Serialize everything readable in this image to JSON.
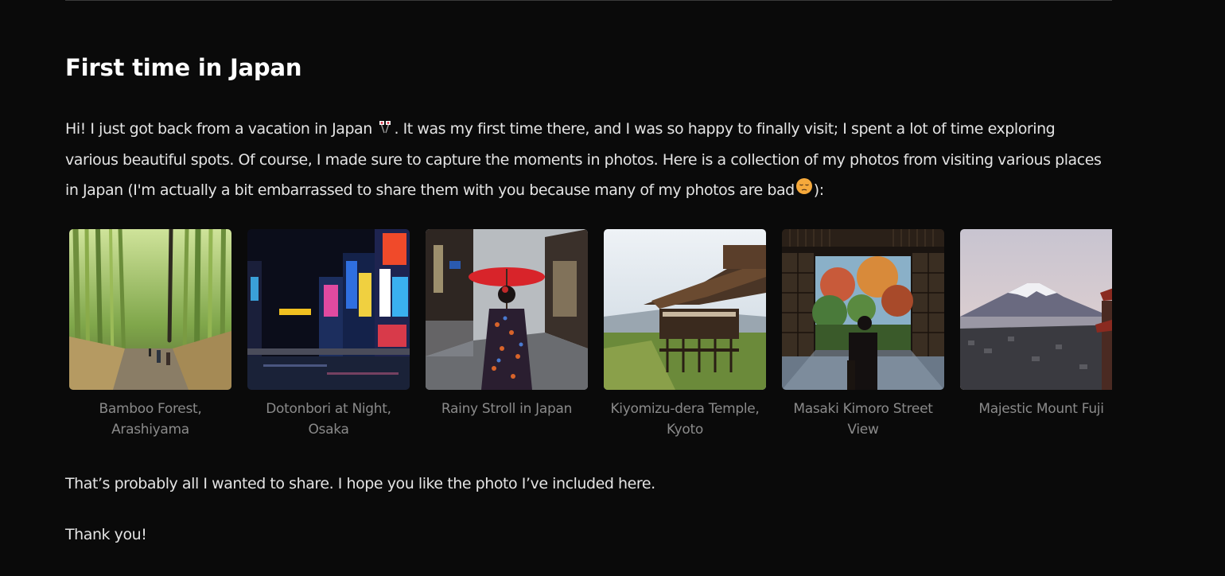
{
  "article": {
    "title": "First time in Japan",
    "intro_part1": "Hi! I just got back from a vacation in Japan ",
    "intro_part2": ". It was my first time there, and I was so happy to finally visit; I spent a lot of time exploring various beautiful spots. Of course, I made sure to capture the moments in photos. Here is a collection of my photos from visiting various places in Japan (I'm actually a bit embarrassed to share them with you because many of my photos are bad",
    "intro_part3": "):",
    "emoji_1": "crossed-flags-emoji",
    "emoji_2": "pensive-face-emoji",
    "closing": "That’s probably all I wanted to share. I hope you like the photo I’ve included here.",
    "thanks": "Thank you!"
  },
  "gallery": {
    "photos": [
      {
        "caption": "Bamboo Forest, Arashiyama"
      },
      {
        "caption": "Dotonbori at Night, Osaka"
      },
      {
        "caption": "Rainy Stroll in Japan"
      },
      {
        "caption": "Kiyomizu-dera Temple, Kyoto"
      },
      {
        "caption": "Masaki Kimoro Street View"
      },
      {
        "caption": "Majestic Mount Fuji"
      }
    ]
  },
  "colors": {
    "background": "#0a0a0a",
    "text": "#e4e4e4",
    "caption": "#8a8a8a"
  }
}
